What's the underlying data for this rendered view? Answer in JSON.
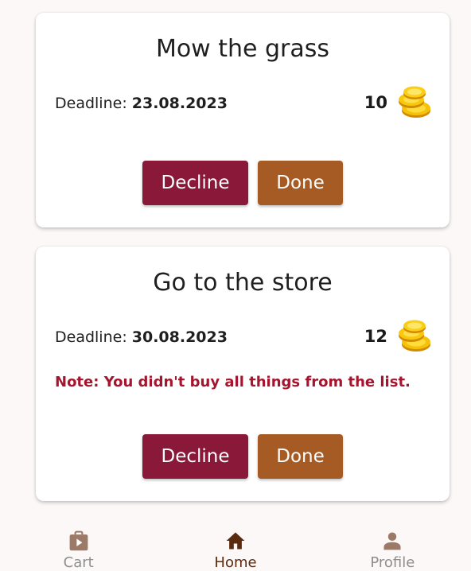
{
  "tasks": [
    {
      "title": "Mow the grass",
      "deadline_label": "Deadline:",
      "deadline_value": "23.08.2023",
      "reward": "10",
      "note": "",
      "decline_label": "Decline",
      "done_label": "Done"
    },
    {
      "title": "Go to the store",
      "deadline_label": "Deadline:",
      "deadline_value": "30.08.2023",
      "reward": "12",
      "note": "Note: You didn't buy all things from the list.",
      "decline_label": "Decline",
      "done_label": "Done"
    }
  ],
  "nav": {
    "items": [
      {
        "label": "Cart",
        "icon": "shopping-bag-icon",
        "active": false
      },
      {
        "label": "Home",
        "icon": "home-icon",
        "active": true
      },
      {
        "label": "Profile",
        "icon": "person-icon",
        "active": false
      }
    ]
  },
  "colors": {
    "decline": "#8a1838",
    "done": "#a65a24",
    "note": "#a5152e",
    "nav_active": "#5a2a0e",
    "nav_inactive": "#8e8e8e",
    "coin": "#f2b705"
  }
}
